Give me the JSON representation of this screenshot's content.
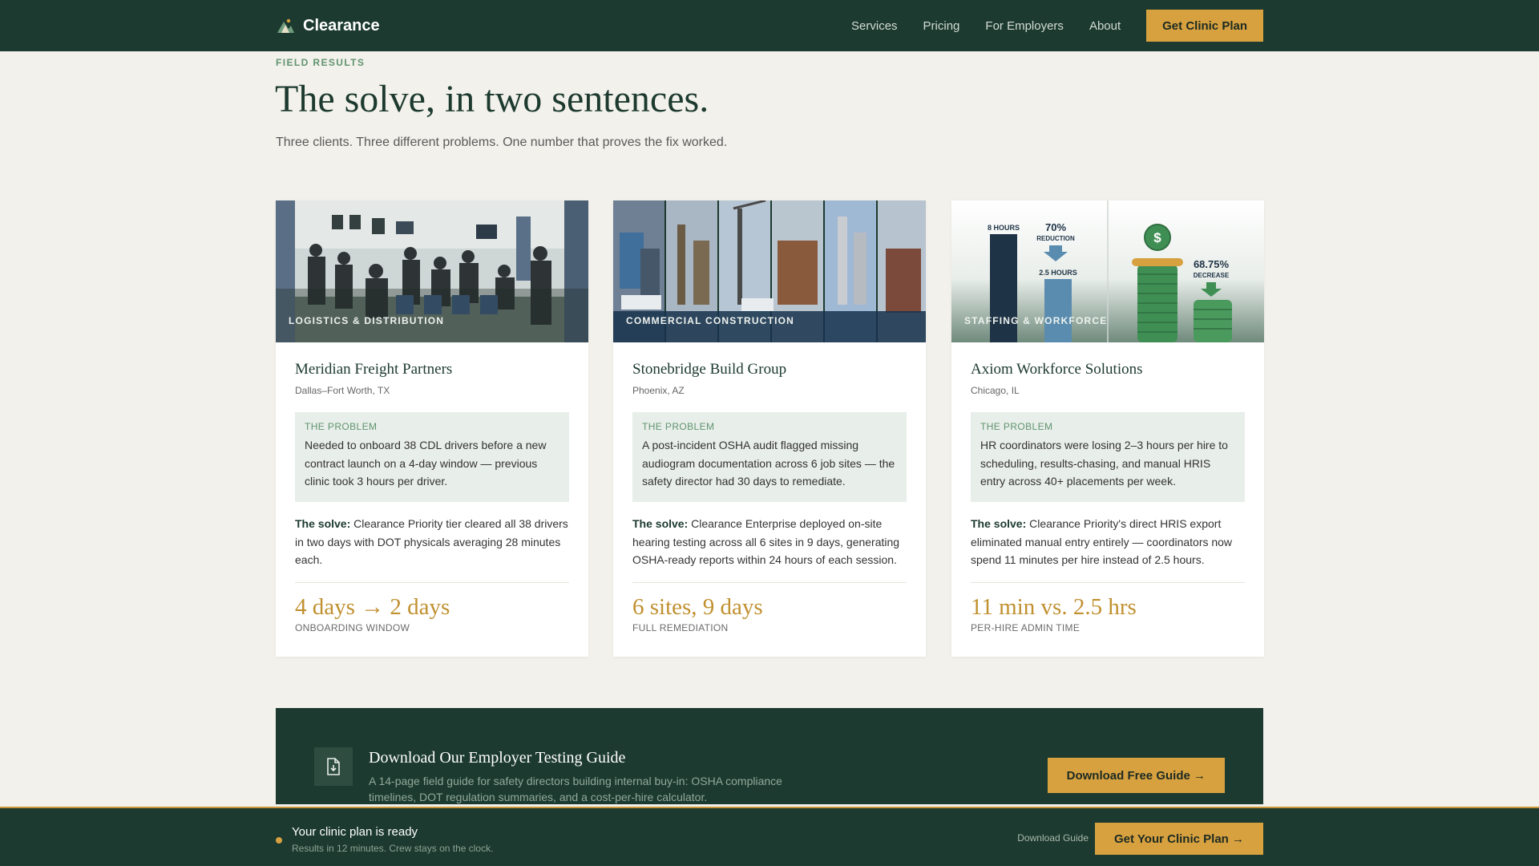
{
  "nav": {
    "brand": "Clearance",
    "links": [
      "Services",
      "Pricing",
      "For Employers",
      "About"
    ],
    "cta": "Get Clinic Plan"
  },
  "hero": {
    "eyebrow": "FIELD RESULTS",
    "title": "The solve, in two sentences.",
    "subtitle": "Three clients. Three different problems. One number that proves the fix worked."
  },
  "cards": [
    {
      "tag": "LOGISTICS & DISTRIBUTION",
      "client": "Meridian Freight Partners",
      "location": "Dallas–Fort Worth, TX",
      "problem_label": "THE PROBLEM",
      "problem": "Needed to onboard 38 CDL drivers before a new contract launch on a 4-day window — previous clinic took 3 hours per driver.",
      "solve_label": "The solve:",
      "solve": "Clearance Priority tier cleared all 38 drivers in two days with DOT physicals averaging 28 minutes each.",
      "metric": "4 days → 2 days",
      "metric_label": "ONBOARDING WINDOW"
    },
    {
      "tag": "COMMERCIAL CONSTRUCTION",
      "client": "Stonebridge Build Group",
      "location": "Phoenix, AZ",
      "problem_label": "THE PROBLEM",
      "problem": "A post-incident OSHA audit flagged missing audiogram documentation across 6 job sites — the safety director had 30 days to remediate.",
      "solve_label": "The solve:",
      "solve": "Clearance Enterprise deployed on-site hearing testing across all 6 sites in 9 days, generating OSHA-ready reports within 24 hours of each session.",
      "metric": "6 sites, 9 days",
      "metric_label": "FULL REMEDIATION"
    },
    {
      "tag": "STAFFING & WORKFORCE",
      "client": "Axiom Workforce Solutions",
      "location": "Chicago, IL",
      "problem_label": "THE PROBLEM",
      "problem": "HR coordinators were losing 2–3 hours per hire to scheduling, results-chasing, and manual HRIS entry across 40+ placements per week.",
      "solve_label": "The solve:",
      "solve": "Clearance Priority's direct HRIS export eliminated manual entry entirely — coordinators now spend 11 minutes per hire instead of 2.5 hours.",
      "metric": "11 min vs. 2.5 hrs",
      "metric_label": "PER-HIRE ADMIN TIME",
      "infographic": {
        "bar_top_label": "8 HOURS",
        "bar_bottom_label": "2.5 HOURS",
        "reduction_value": "70%",
        "reduction_label": "REDUCTION",
        "decrease_value": "68.75%",
        "decrease_label": "DECREASE",
        "coin_symbol": "$"
      }
    }
  ],
  "guide": {
    "title": "Download Our Employer Testing Guide",
    "text": "A 14-page field guide for safety directors building internal buy-in: OSHA compliance timelines, DOT regulation summaries, and a cost-per-hire calculator.",
    "button": "Download Free Guide →"
  },
  "sticky": {
    "title": "Your clinic plan is ready",
    "subtitle": "Results in 12 minutes. Crew stays on the clock.",
    "link": "Download Guide",
    "button": "Get Your Clinic Plan →"
  },
  "colors": {
    "primary": "#1c3a2f",
    "accent": "#d8a13f",
    "background": "#f3f1eb",
    "problem_bg": "#e8eee9",
    "metric": "#c0902f"
  }
}
